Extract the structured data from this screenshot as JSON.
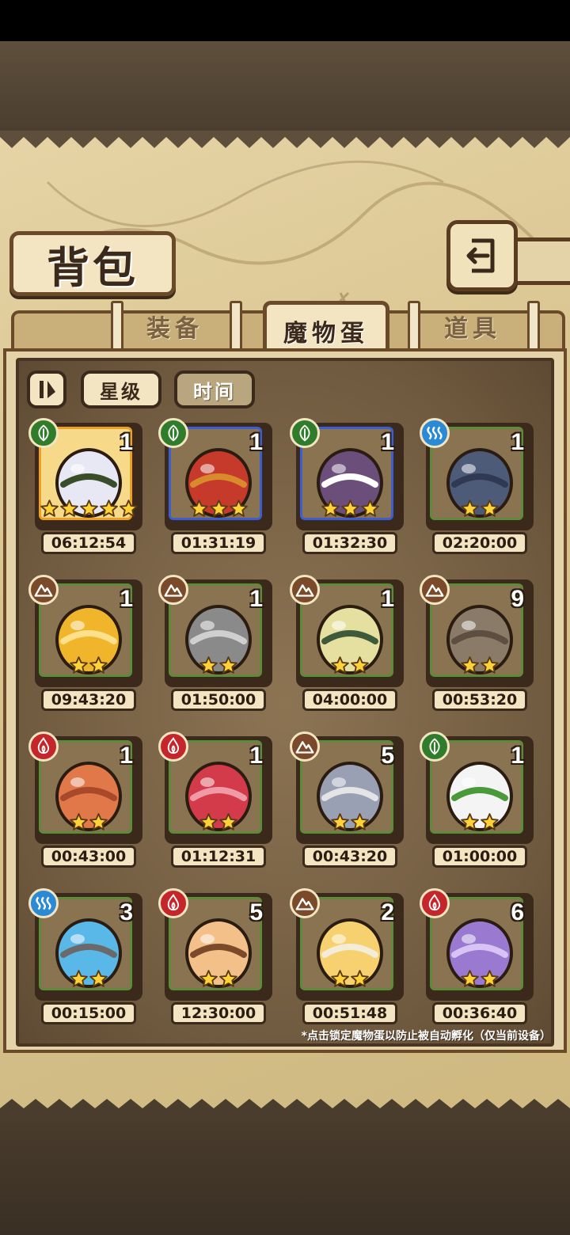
{
  "title": "背包",
  "tabs": [
    {
      "label": "装备"
    },
    {
      "label": "魔物蛋"
    },
    {
      "label": "道具"
    }
  ],
  "sort": {
    "star_label": "星级",
    "time_label": "时间"
  },
  "eggs": [
    {
      "element": "grass",
      "count": "1",
      "stars": 5,
      "timer": "06:12:54",
      "rarity": "gold",
      "color": "#e8e8f4",
      "accent": "#3a4d2a"
    },
    {
      "element": "grass",
      "count": "1",
      "stars": 3,
      "timer": "01:31:19",
      "rarity": "blue",
      "color": "#c63a2c",
      "accent": "#d98a2a"
    },
    {
      "element": "grass",
      "count": "1",
      "stars": 3,
      "timer": "01:32:30",
      "rarity": "blue",
      "color": "#6b4f7a",
      "accent": "#ffffff"
    },
    {
      "element": "water",
      "count": "1",
      "stars": 2,
      "timer": "02:20:00",
      "rarity": "green",
      "color": "#4d5a78",
      "accent": "#2f3a52"
    },
    {
      "element": "earth",
      "count": "1",
      "stars": 2,
      "timer": "09:43:20",
      "rarity": "green",
      "color": "#f0b52a",
      "accent": "#ffe08a"
    },
    {
      "element": "earth",
      "count": "1",
      "stars": 2,
      "timer": "01:50:00",
      "rarity": "green",
      "color": "#8a8a8a",
      "accent": "#cfcfcf"
    },
    {
      "element": "earth",
      "count": "1",
      "stars": 2,
      "timer": "04:00:00",
      "rarity": "green",
      "color": "#e6e0a0",
      "accent": "#3f5a3a"
    },
    {
      "element": "earth",
      "count": "9",
      "stars": 2,
      "timer": "00:53:20",
      "rarity": "green",
      "color": "#8a7a68",
      "accent": "#5c4e40"
    },
    {
      "element": "fire",
      "count": "1",
      "stars": 2,
      "timer": "00:43:00",
      "rarity": "green",
      "color": "#e0784a",
      "accent": "#a84a2a"
    },
    {
      "element": "fire",
      "count": "1",
      "stars": 2,
      "timer": "01:12:31",
      "rarity": "green",
      "color": "#d33a4a",
      "accent": "#f09aa8"
    },
    {
      "element": "earth",
      "count": "5",
      "stars": 2,
      "timer": "00:43:20",
      "rarity": "green",
      "color": "#9aa0b4",
      "accent": "#e4e4e4"
    },
    {
      "element": "grass",
      "count": "1",
      "stars": 2,
      "timer": "01:00:00",
      "rarity": "green",
      "color": "#f4f4f4",
      "accent": "#4a9a3a"
    },
    {
      "element": "water",
      "count": "3",
      "stars": 2,
      "timer": "00:15:00",
      "rarity": "green",
      "color": "#5ab8e8",
      "accent": "#6a6a6a"
    },
    {
      "element": "fire",
      "count": "5",
      "stars": 2,
      "timer": "12:30:00",
      "rarity": "green",
      "color": "#f3c08a",
      "accent": "#7a4a2a"
    },
    {
      "element": "earth",
      "count": "2",
      "stars": 2,
      "timer": "00:51:48",
      "rarity": "green",
      "color": "#f7d070",
      "accent": "#f3ecd8"
    },
    {
      "element": "fire",
      "count": "6",
      "stars": 2,
      "timer": "00:36:40",
      "rarity": "green",
      "color": "#9a7ad0",
      "accent": "#d8c4f4"
    }
  ],
  "hint": "*点击锁定魔物蛋以防止被自动孵化（仅当前设备）"
}
